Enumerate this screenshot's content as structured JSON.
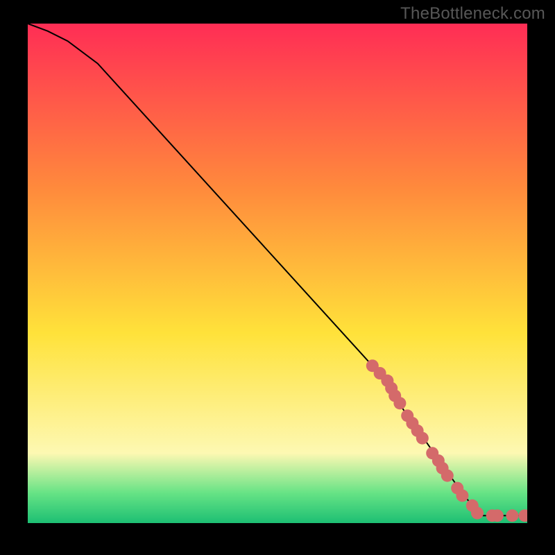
{
  "watermark": "TheBottleneck.com",
  "colors": {
    "bg_black": "#000000",
    "gradient_top": "#ff2d55",
    "gradient_orange": "#ff8a3c",
    "gradient_yellow": "#ffe23a",
    "gradient_pale": "#fdf8b2",
    "gradient_mint": "#66e385",
    "gradient_green": "#1dbf73",
    "curve_stroke": "#000000",
    "dot_fill": "#d46a6a",
    "watermark_color": "#575757"
  },
  "chart_data": {
    "type": "line",
    "title": "",
    "xlabel": "",
    "ylabel": "",
    "x_range": [
      0,
      100
    ],
    "y_range": [
      0,
      100
    ],
    "series": [
      {
        "name": "curve",
        "style": "solid-black",
        "points": [
          {
            "x": 0,
            "y": 100
          },
          {
            "x": 4,
            "y": 98.5
          },
          {
            "x": 8,
            "y": 96.5
          },
          {
            "x": 14,
            "y": 92
          },
          {
            "x": 69,
            "y": 31.5
          },
          {
            "x": 87,
            "y": 6
          },
          {
            "x": 89,
            "y": 3.5
          },
          {
            "x": 90,
            "y": 2
          },
          {
            "x": 91,
            "y": 1.5
          },
          {
            "x": 100,
            "y": 1.5
          }
        ]
      },
      {
        "name": "dots",
        "style": "coral-dots",
        "points": [
          {
            "x": 69,
            "y": 31.5
          },
          {
            "x": 70.5,
            "y": 30
          },
          {
            "x": 72,
            "y": 28.5
          },
          {
            "x": 72.8,
            "y": 27
          },
          {
            "x": 73.5,
            "y": 25.5
          },
          {
            "x": 74.5,
            "y": 24
          },
          {
            "x": 76,
            "y": 21.5
          },
          {
            "x": 77,
            "y": 20
          },
          {
            "x": 78,
            "y": 18.5
          },
          {
            "x": 79,
            "y": 17
          },
          {
            "x": 81,
            "y": 14
          },
          {
            "x": 82.2,
            "y": 12.5
          },
          {
            "x": 83,
            "y": 11
          },
          {
            "x": 84,
            "y": 9.5
          },
          {
            "x": 86,
            "y": 7
          },
          {
            "x": 87,
            "y": 5.5
          },
          {
            "x": 89,
            "y": 3.5
          },
          {
            "x": 90,
            "y": 2
          },
          {
            "x": 93,
            "y": 1.5
          },
          {
            "x": 94,
            "y": 1.5
          },
          {
            "x": 97,
            "y": 1.5
          },
          {
            "x": 99.5,
            "y": 1.5
          }
        ]
      }
    ]
  }
}
